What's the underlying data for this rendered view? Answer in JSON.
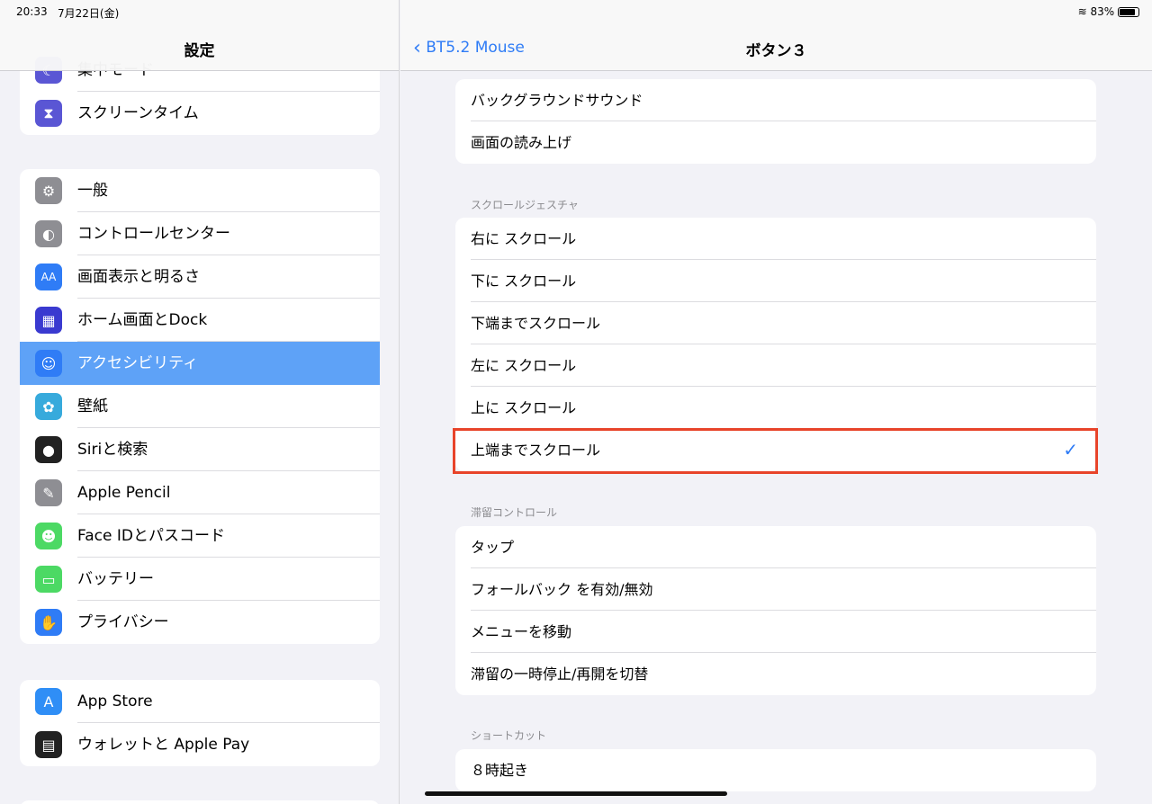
{
  "status": {
    "time": "20:33",
    "date": "7月22日(金)",
    "battery": "83%"
  },
  "sidebar": {
    "title": "設定",
    "group1": [
      {
        "label": "集中モード",
        "icon": "moon-icon",
        "color": "#5a56d4"
      },
      {
        "label": "スクリーンタイム",
        "icon": "hourglass-icon",
        "color": "#5a56d4"
      }
    ],
    "group2": [
      {
        "label": "一般",
        "icon": "gear-icon",
        "color": "#8e8e93"
      },
      {
        "label": "コントロールセンター",
        "icon": "toggles-icon",
        "color": "#8e8e93"
      },
      {
        "label": "画面表示と明るさ",
        "icon": "text-size-icon",
        "color": "#2f7cf6"
      },
      {
        "label": "ホーム画面とDock",
        "icon": "grid-icon",
        "color": "#3a3ad0"
      },
      {
        "label": "アクセシビリティ",
        "icon": "accessibility-icon",
        "color": "#2f7cf6",
        "selected": true
      },
      {
        "label": "壁紙",
        "icon": "flower-icon",
        "color": "#37aadc"
      },
      {
        "label": "Siriと検索",
        "icon": "siri-icon",
        "color": "#222"
      },
      {
        "label": "Apple Pencil",
        "icon": "pencil-icon",
        "color": "#8e8e93"
      },
      {
        "label": "Face IDとパスコード",
        "icon": "faceid-icon",
        "color": "#4cd964"
      },
      {
        "label": "バッテリー",
        "icon": "battery-icon",
        "color": "#4cd964"
      },
      {
        "label": "プライバシー",
        "icon": "hand-icon",
        "color": "#2f7cf6"
      }
    ],
    "group3": [
      {
        "label": "App Store",
        "icon": "appstore-icon",
        "color": "#2f8ef6"
      },
      {
        "label": "ウォレットと Apple Pay",
        "icon": "wallet-icon",
        "color": "#222"
      }
    ]
  },
  "detail": {
    "back_label": "BT5.2 Mouse",
    "title": "ボタン３",
    "group1": [
      "バックグラウンドサウンド",
      "画面の読み上げ"
    ],
    "scroll_header": "スクロールジェスチャ",
    "scroll": [
      "右に スクロール",
      "下に スクロール",
      "下端までスクロール",
      "左に スクロール",
      "上に スクロール",
      "上端までスクロール"
    ],
    "selected": "上端までスクロール",
    "dwell_header": "滞留コントロール",
    "dwell": [
      "タップ",
      "フォールバック を有効/無効",
      "メニューを移動",
      "滞留の一時停止/再開を切替"
    ],
    "shortcut_header": "ショートカット",
    "shortcuts": [
      "８時起き"
    ],
    "highlight_color": "#e8442a",
    "accent": "#2f7cf6"
  }
}
